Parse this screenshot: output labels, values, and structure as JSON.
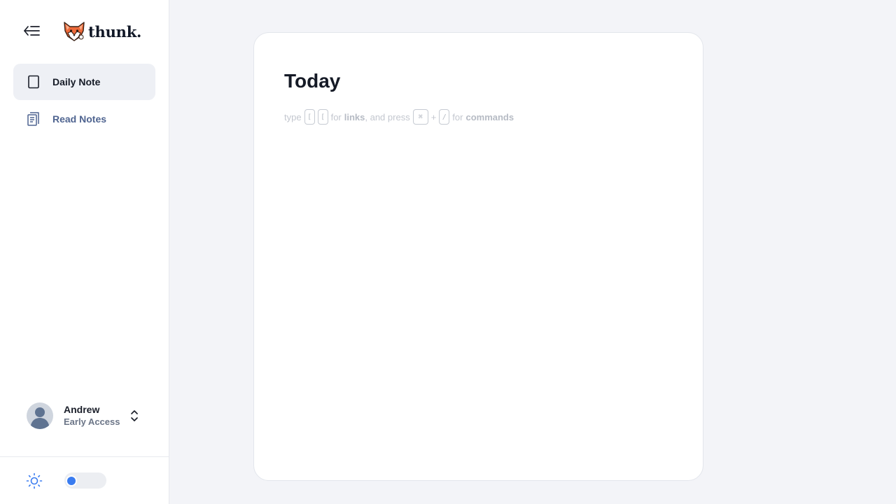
{
  "app": {
    "brand_name": "thunk.",
    "accent_color": "#3a7cf0"
  },
  "sidebar": {
    "collapse_icon": "arrow-left-lines-icon",
    "items": [
      {
        "label": "Daily Note",
        "icon": "page-icon",
        "active": true
      },
      {
        "label": "Read Notes",
        "icon": "document-lines-icon",
        "active": false
      }
    ],
    "user": {
      "name": "Andrew",
      "plan": "Early Access",
      "chevron_icon": "chevron-up-down-icon"
    },
    "footer": {
      "theme_icon": "sun-icon",
      "dark_mode_enabled": false
    }
  },
  "editor": {
    "title": "Today",
    "hint": {
      "type_word": "type",
      "key_open_1": "[",
      "key_open_2": "[",
      "for_1": "for",
      "links": "links",
      "and_press": ", and press",
      "key_cmd": "⌘",
      "plus": "+",
      "key_slash": "/",
      "for_2": "for",
      "commands": "commands"
    }
  }
}
